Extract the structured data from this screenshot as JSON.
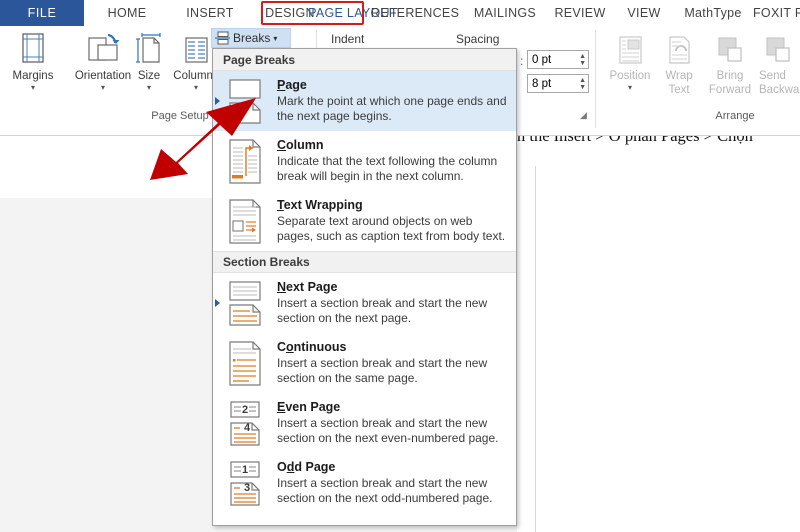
{
  "app": {
    "title": "Microsoft Word - Page Layout ribbon with Breaks menu open",
    "accent_blue": "#2b579a",
    "highlight_red": "#d51c1c",
    "menu_selected_blue": "#dce9f7"
  },
  "tabs": {
    "file_label": "FILE",
    "items": [
      {
        "label": "HOME",
        "active": false
      },
      {
        "label": "INSERT",
        "active": false
      },
      {
        "label": "DESIGN",
        "active": false
      },
      {
        "label": "PAGE LAYOUT",
        "active": true
      },
      {
        "label": "REFERENCES",
        "active": false
      },
      {
        "label": "MAILINGS",
        "active": false
      },
      {
        "label": "REVIEW",
        "active": false
      },
      {
        "label": "VIEW",
        "active": false
      },
      {
        "label": "MathType",
        "active": false
      },
      {
        "label": "FOXIT R",
        "active": false
      }
    ]
  },
  "ribbon": {
    "page_setup": {
      "group_label": "Page Setup",
      "buttons": [
        {
          "label": "Margins",
          "icon": "margins-icon",
          "has_caret": true
        },
        {
          "label": "Orientation",
          "icon": "orientation-icon",
          "has_caret": true
        },
        {
          "label": "Size",
          "icon": "size-icon",
          "has_caret": true
        },
        {
          "label": "Columns",
          "icon": "columns-icon",
          "has_caret": true
        }
      ],
      "breaks_button": {
        "label": "Breaks",
        "icon": "breaks-icon",
        "caret": "▾"
      }
    },
    "paragraph": {
      "indent_label": "Indent",
      "spacing_label": "Spacing",
      "spacing_before": "0 pt",
      "spacing_after": "8 pt",
      "dialog_launcher": "dialog-launcher-icon"
    },
    "arrange": {
      "group_label": "Arrange",
      "buttons": [
        {
          "label": "Position",
          "sublabel": "",
          "icon": "position-icon",
          "has_caret": true,
          "disabled": true
        },
        {
          "label": "Wrap",
          "sublabel": "Text",
          "icon": "wrap-text-icon",
          "has_caret": true,
          "disabled": true
        },
        {
          "label": "Bring",
          "sublabel": "Forward",
          "icon": "bring-forward-icon",
          "has_caret": true,
          "disabled": true
        },
        {
          "label": "Send",
          "sublabel": "Backward",
          "icon": "send-backward-icon",
          "has_caret": true,
          "disabled": true
        }
      ]
    }
  },
  "breaks_menu": {
    "page_breaks_header": "Page Breaks",
    "section_breaks_header": "Section Breaks",
    "page_breaks": [
      {
        "title": "Page",
        "accesskey": "P",
        "description": "Mark the point at which one page ends and the next page begins.",
        "icon": "page-break-icon",
        "selected": true
      },
      {
        "title": "Column",
        "accesskey": "C",
        "description": "Indicate that the text following the column break will begin in the next column.",
        "icon": "column-break-icon",
        "selected": false
      },
      {
        "title": "Text Wrapping",
        "accesskey": "T",
        "description": "Separate text around objects on web pages, such as caption text from body text.",
        "icon": "text-wrapping-break-icon",
        "selected": false
      }
    ],
    "section_breaks": [
      {
        "title": "Next Page",
        "accesskey": "N",
        "description": "Insert a section break and start the new section on the next page.",
        "icon": "next-page-section-icon",
        "selected": false
      },
      {
        "title": "Continuous",
        "accesskey": "o",
        "description": "Insert a section break and start the new section on the same page.",
        "icon": "continuous-section-icon",
        "selected": false
      },
      {
        "title": "Even Page",
        "accesskey": "E",
        "description": "Insert a section break and start the new section on the next even-numbered page.",
        "icon": "even-page-section-icon",
        "page_numbers": [
          "2",
          "4"
        ],
        "selected": false
      },
      {
        "title": "Odd Page",
        "accesskey": "d",
        "description": "Insert a section break and start the new section on the next odd-numbered page.",
        "icon": "odd-page-section-icon",
        "page_numbers": [
          "1",
          "3"
        ],
        "selected": false
      }
    ]
  },
  "document": {
    "visible_text": "n the Insert > Ở phần Pages > Chọn"
  },
  "annotation": {
    "arrow": "red-arrow-pointing-to-page-break-item",
    "arrow_color": "#c00000"
  }
}
